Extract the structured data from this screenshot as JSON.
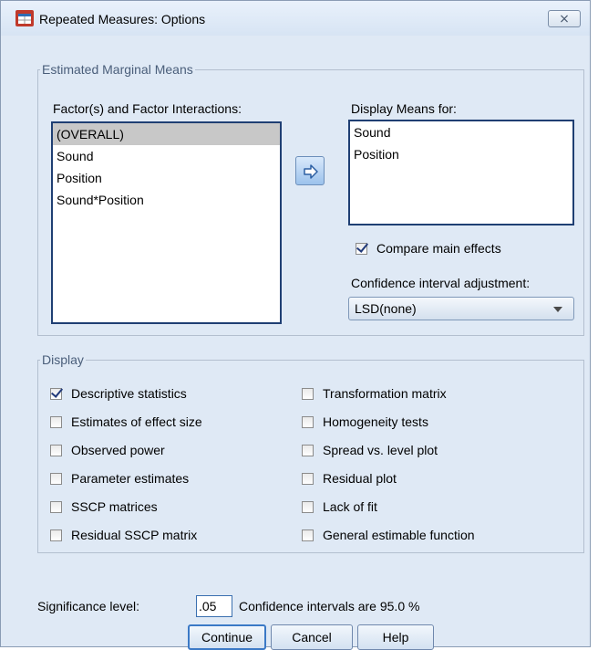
{
  "window": {
    "title": "Repeated Measures: Options",
    "close_glyph": "⨯"
  },
  "emm": {
    "legend": "Estimated Marginal Means",
    "factors_label": "Factor(s) and Factor Interactions:",
    "factors": [
      "(OVERALL)",
      "Sound",
      "Position",
      "Sound*Position"
    ],
    "display_label": "Display Means for:",
    "display": [
      "Sound",
      "Position"
    ],
    "compare_label": "Compare main effects",
    "compare_checked": true,
    "ci_adjust_label": "Confidence interval adjustment:",
    "ci_adjust_value": "LSD(none)"
  },
  "display": {
    "legend": "Display",
    "left": [
      {
        "label": "Descriptive statistics",
        "checked": true
      },
      {
        "label": "Estimates of effect size",
        "checked": false
      },
      {
        "label": "Observed power",
        "checked": false
      },
      {
        "label": "Parameter estimates",
        "checked": false
      },
      {
        "label": "SSCP matrices",
        "checked": false
      },
      {
        "label": "Residual SSCP matrix",
        "checked": false
      }
    ],
    "right": [
      {
        "label": "Transformation matrix",
        "checked": false
      },
      {
        "label": "Homogeneity tests",
        "checked": false
      },
      {
        "label": "Spread vs. level plot",
        "checked": false
      },
      {
        "label": "Residual plot",
        "checked": false
      },
      {
        "label": "Lack of fit",
        "checked": false
      },
      {
        "label": "General estimable function",
        "checked": false
      }
    ]
  },
  "significance": {
    "label": "Significance level:",
    "value": ".05",
    "ci_text": "Confidence intervals are 95.0 %"
  },
  "buttons": {
    "continue": "Continue",
    "cancel": "Cancel",
    "help": "Help"
  },
  "colors": {
    "dialog_bg": "#dfe9f5",
    "list_border": "#1f3f73",
    "selection": "#c8c8c8",
    "default_button": "#3b79c6"
  }
}
